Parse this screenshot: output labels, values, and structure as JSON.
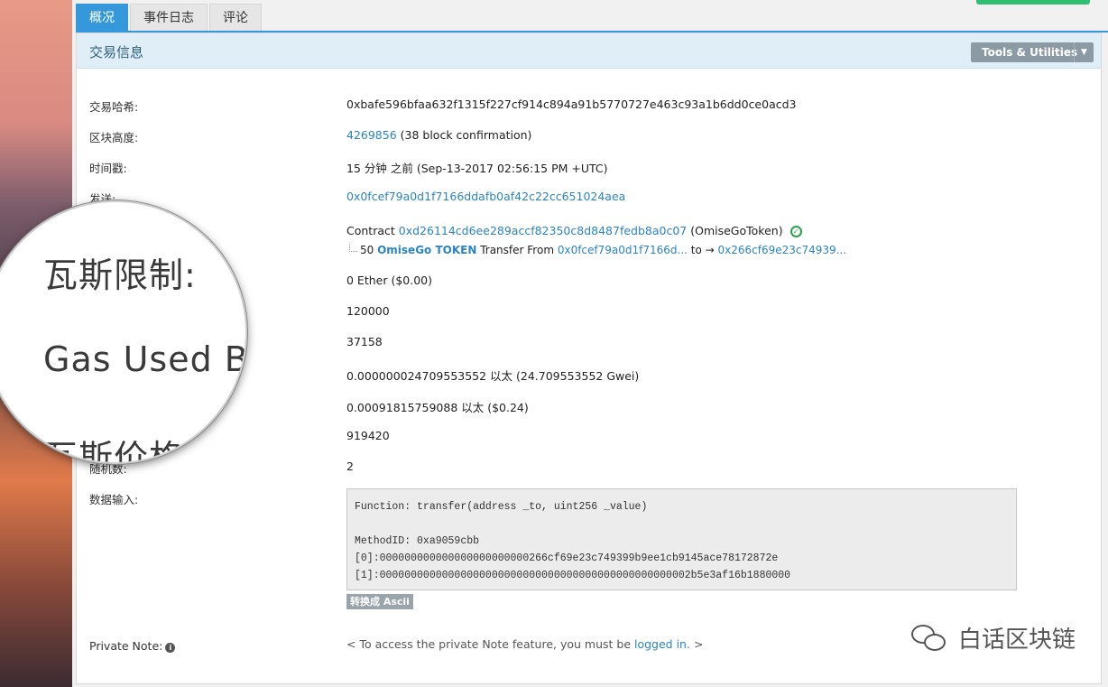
{
  "tabs": [
    "概况",
    "事件日志",
    "评论"
  ],
  "panel": {
    "title": "交易信息",
    "tools_label": "Tools & Utilities"
  },
  "rows": {
    "txhash": {
      "label": "交易哈希:",
      "value": "0xbafe596bfaa632f1315f227cf914c894a91b5770727e463c93a1b6dd0ce0acd3"
    },
    "block": {
      "label": "区块高度:",
      "link": "4269856",
      "suffix": " (38 block confirmation)"
    },
    "timestamp": {
      "label": "时间戳:",
      "value": "15 分钟 之前 (Sep-13-2017 02:56:15 PM +UTC)"
    },
    "from": {
      "label": "发送:",
      "link": "0x0fcef79a0d1f7166ddafb0af42c22cc651024aea"
    },
    "to": {
      "prefix": "Contract ",
      "link": "0xd26114cd6ee289accf82350c8d8487fedb8a0c07",
      "suffix": " (OmiseGoToken)"
    },
    "transfer": {
      "amount": "50 ",
      "token": "OmiseGo TOKEN",
      "mid": " Transfer From ",
      "from": "0x0fcef79a0d1f7166d...",
      "arrow": " to → ",
      "to": "0x266cf69e23c74939..."
    },
    "value": "0 Ether ($0.00)",
    "gas_limit": "120000",
    "gas_used": "37158",
    "gas_price": "0.000000024709553552 以太 (24.709553552 Gwei)",
    "actual_fee": "0.00091815759088 以太 ($0.24)",
    "cumulative_gas": "919420",
    "nonce": {
      "label": "随机数:",
      "value": "2"
    },
    "input": {
      "label": "数据输入:",
      "text": "Function: transfer(address _to, uint256 _value)\n\nMethodID: 0xa9059cbb\n[0]:000000000000000000000000266cf69e23c749399b9ee1cb9145ace78172872e\n[1]:00000000000000000000000000000000000000000000000002b5e3af16b1880000",
      "ascii_button": "转换成 Ascii"
    },
    "private_note": {
      "label": "Private Note:",
      "prefix": "< To access the private Note feature, you must be ",
      "link": "logged in.",
      "suffix": " >"
    }
  },
  "magnifier": {
    "line1": "瓦斯限制:",
    "line2": "Gas Used By",
    "line3": "瓦斯价格"
  },
  "watermark": "白话区块链"
}
